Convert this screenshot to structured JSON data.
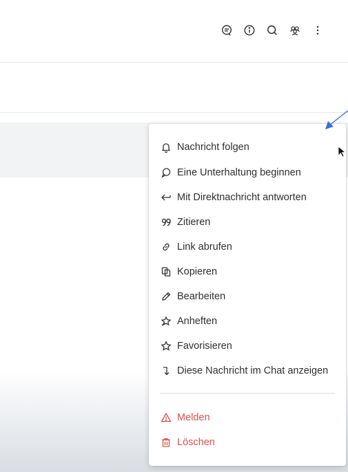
{
  "header": {
    "icons": [
      "threads-icon",
      "info-icon",
      "search-icon",
      "members-icon",
      "kebab-menu-icon"
    ]
  },
  "menu": {
    "items": [
      {
        "label": "Nachricht folgen",
        "icon": "bell-icon"
      },
      {
        "label": "Eine Unterhaltung beginnen",
        "icon": "discussion-icon"
      },
      {
        "label": "Mit Direktnachricht antworten",
        "icon": "reply-arrow-icon"
      },
      {
        "label": "Zitieren",
        "icon": "quote-icon"
      },
      {
        "label": "Link abrufen",
        "icon": "link-icon"
      },
      {
        "label": "Kopieren",
        "icon": "copy-icon"
      },
      {
        "label": "Bearbeiten",
        "icon": "pencil-icon"
      },
      {
        "label": "Anheften",
        "icon": "pin-icon"
      },
      {
        "label": "Favorisieren",
        "icon": "star-icon"
      },
      {
        "label": "Diese Nachricht im Chat anzeigen",
        "icon": "jump-to-message-icon"
      }
    ],
    "danger_items": [
      {
        "label": "Melden",
        "icon": "warning-icon"
      },
      {
        "label": "Löschen",
        "icon": "trash-icon"
      }
    ]
  },
  "colors": {
    "danger": "#d9534f",
    "annotation_arrow": "#3b6fd4",
    "text": "#2f2f2f"
  }
}
